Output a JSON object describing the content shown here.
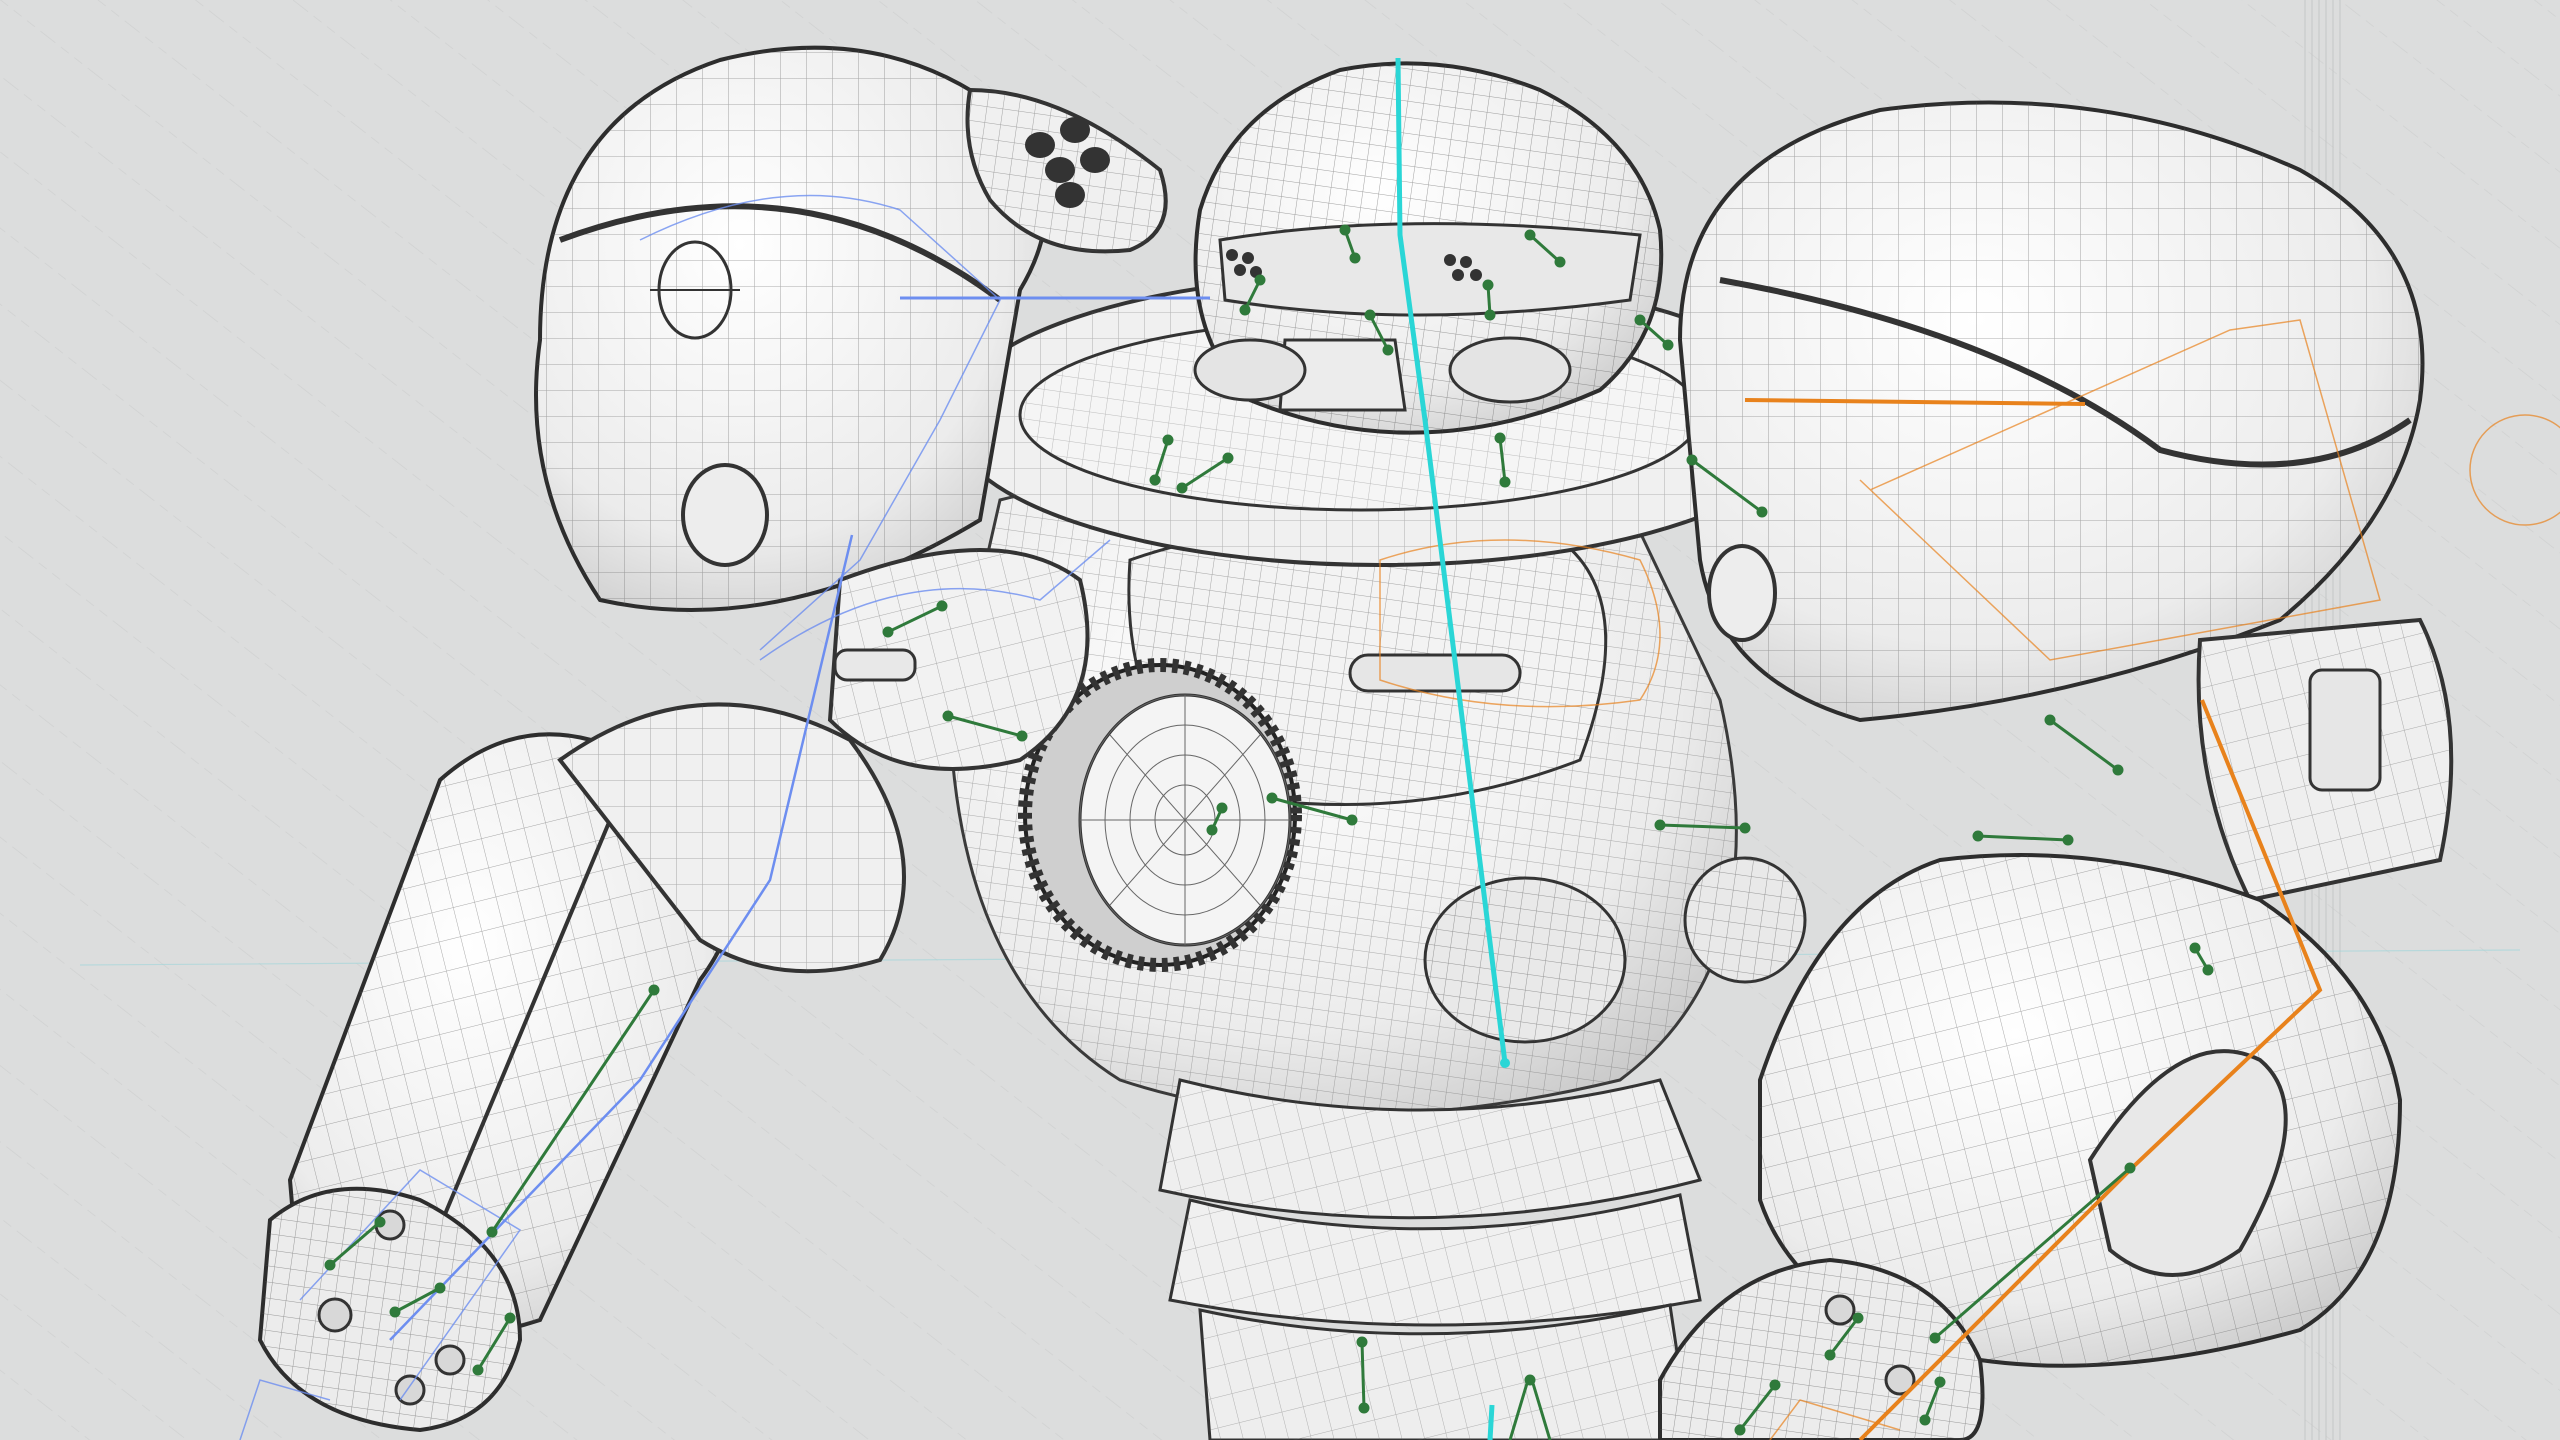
{
  "viewport": {
    "background_color": "#dcdddd",
    "wire_color": "#444444",
    "shell_color": "#f1f1f1",
    "spine_color": "#2ad6d6",
    "left_arm_color": "#6d8ef0",
    "right_arm_color": "#e8821c",
    "bone_color": "#2f7a3b"
  }
}
